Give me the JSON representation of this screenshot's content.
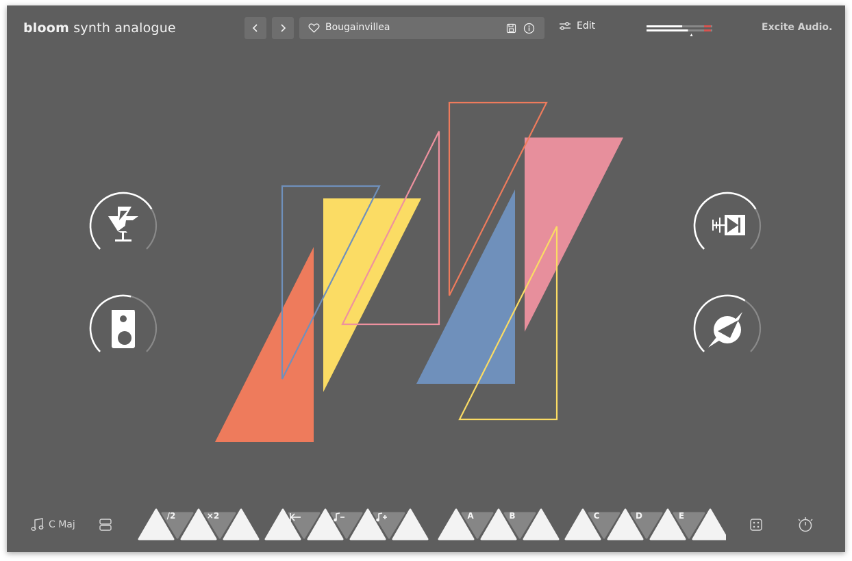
{
  "app": {
    "brand_bold": "bloom",
    "brand_rest": "synth analogue",
    "vendor": "Excite Audio."
  },
  "header": {
    "prev_icon": "chevron-left-icon",
    "next_icon": "chevron-right-icon",
    "preset_name": "Bougainvillea",
    "favorite_icon": "heart-icon",
    "save_icon": "save-icon",
    "info_icon": "info-icon",
    "edit_label": "Edit",
    "edit_icon": "sliders-icon"
  },
  "meter": {
    "level": 0.62,
    "peak": 0.78
  },
  "knobs": [
    {
      "name": "microphone-knob",
      "icon": "microphone-icon",
      "value": 0.72
    },
    {
      "name": "speaker-knob",
      "icon": "speaker-icon",
      "value": 0.55
    },
    {
      "name": "filter-knob",
      "icon": "diode-icon",
      "value": 0.72
    },
    {
      "name": "drive-knob",
      "icon": "compass-icon",
      "value": 0.62
    }
  ],
  "colors": {
    "background": "#5e5e5e",
    "orange": "#ee7b5c",
    "yellow": "#fbdc64",
    "blue": "#6f90bb",
    "pink": "#ee919f"
  },
  "footer": {
    "key_label": "C Maj",
    "key_icon": "music-note-icon",
    "layout_icon": "layers-icon",
    "random_icon": "dice-icon",
    "timer_icon": "timer-icon",
    "step_labels": [
      "/2",
      "×2",
      "",
      "",
      "A",
      "B",
      "C",
      "D",
      "E"
    ]
  }
}
